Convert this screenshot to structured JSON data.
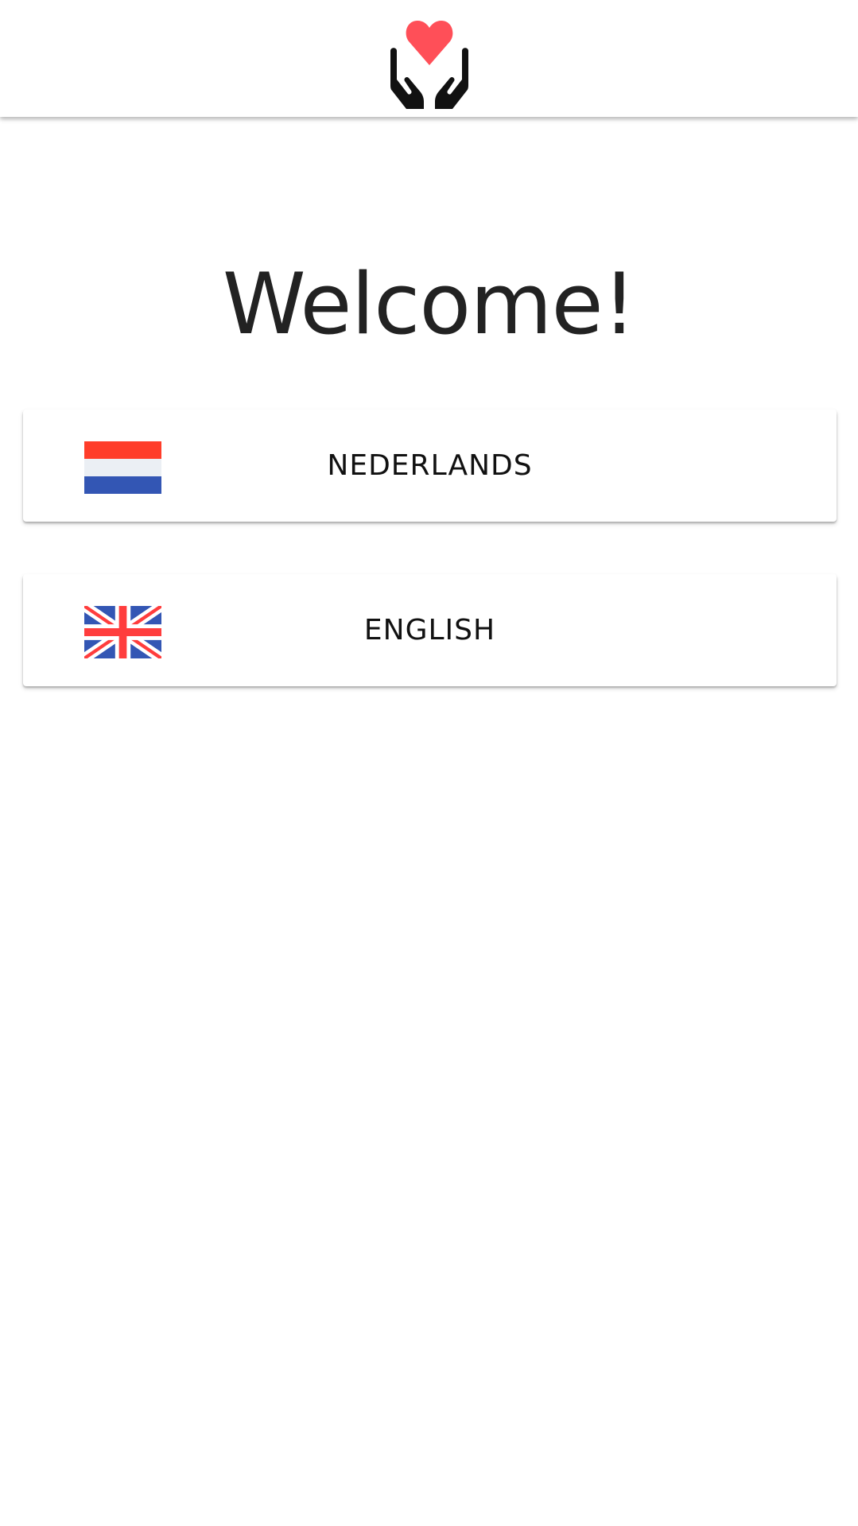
{
  "header": {
    "logo_icon": "hands-holding-heart-icon",
    "logo_colors": {
      "heart": "#ff4f58",
      "hands": "#111111"
    }
  },
  "main": {
    "title": "Welcome!"
  },
  "languages": [
    {
      "label": "NEDERLANDS",
      "flag_icon": "netherlands-flag-icon",
      "flag_colors": [
        "#ff3d2a",
        "#ebeff4",
        "#3356b4"
      ]
    },
    {
      "label": "ENGLISH",
      "flag_icon": "united-kingdom-flag-icon",
      "flag_colors": [
        "#3356b4",
        "#ffffff",
        "#ff3d3d"
      ]
    }
  ]
}
